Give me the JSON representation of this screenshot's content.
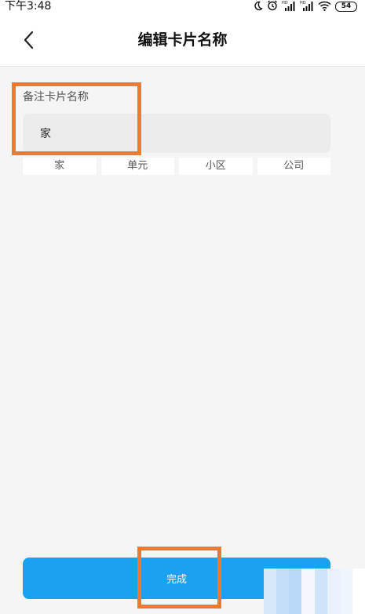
{
  "status_bar": {
    "time": "下午3:48",
    "icons": [
      "moon-icon",
      "alarm-icon",
      "hd-signal-icon",
      "hd-signal-icon",
      "wifi-icon",
      "battery-icon"
    ],
    "battery": "54"
  },
  "header": {
    "back_icon": "chevron-left-icon",
    "title": "编辑卡片名称"
  },
  "form": {
    "label": "备注卡片名称",
    "name_value": "家"
  },
  "suggestions": [
    "家",
    "单元",
    "小区",
    "公司"
  ],
  "done_label": "完成",
  "colors": {
    "accent": "#1aa1f0",
    "highlight": "#f07a2a",
    "background": "#f5f5f5"
  }
}
